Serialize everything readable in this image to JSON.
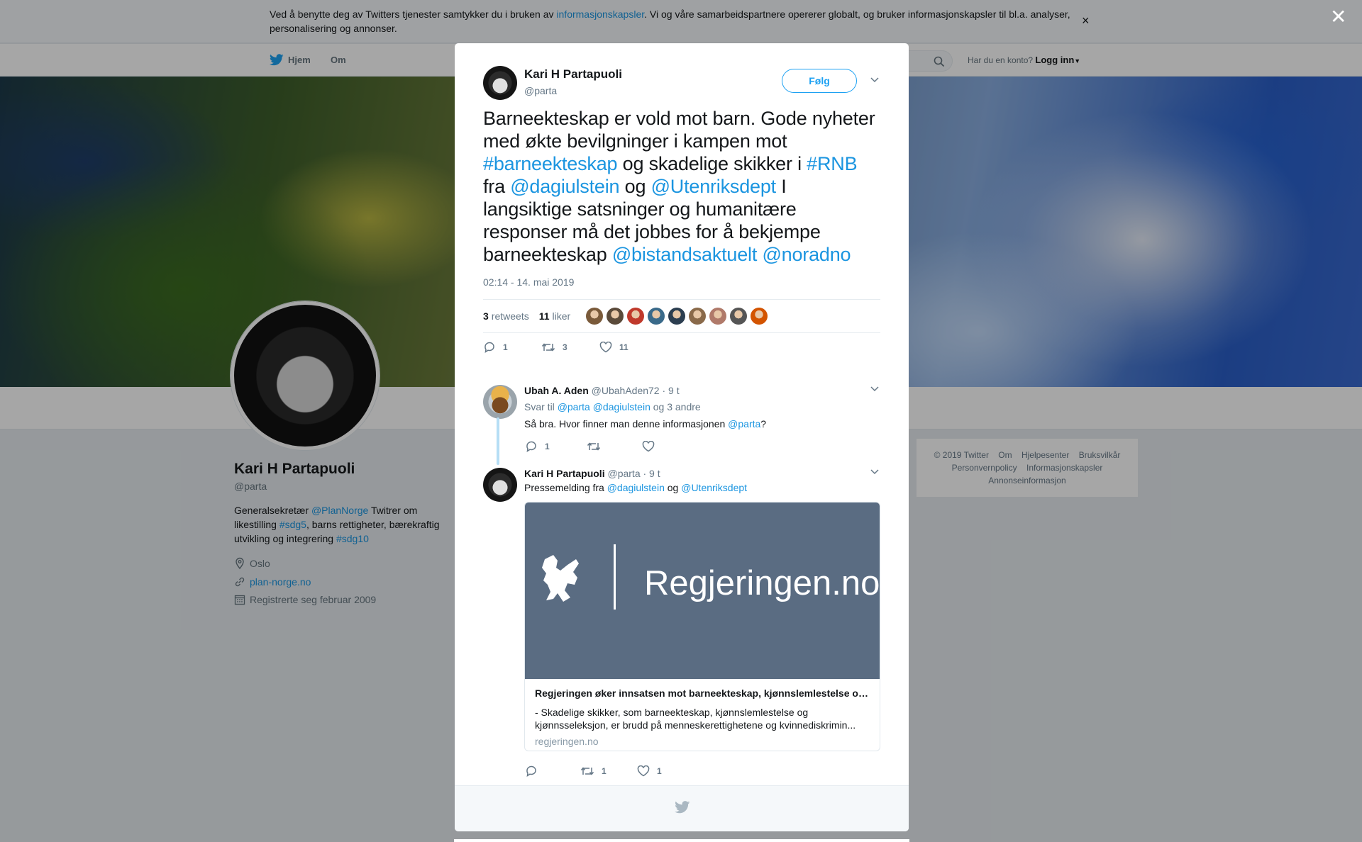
{
  "cookie_bar": {
    "text_before": "Ved å benytte deg av Twitters tjenester samtykker du i bruken av ",
    "link": "informasjonskapsler",
    "text_after": ". Vi og våre samarbeidspartnere opererer globalt, og bruker informasjonskapsler til bl.a. analyser, personalisering og annonser.",
    "close": "×"
  },
  "nav": {
    "home": "Hjem",
    "about": "Om",
    "have_account": "Har du en konto?",
    "login": "Logg inn"
  },
  "page_close": "✕",
  "profile": {
    "name": "Kari H Partapuoli",
    "handle": "@parta",
    "bio": [
      {
        "t": "Generalsekretær ",
        "link": false
      },
      {
        "t": "@PlanNorge",
        "link": true
      },
      {
        "t": " Twitrer om likestilling ",
        "link": false
      },
      {
        "t": "#sdg5",
        "link": true
      },
      {
        "t": ", barns rettigheter, bærekraftig utvikling og integrering ",
        "link": false
      },
      {
        "t": "#sdg10",
        "link": true
      }
    ],
    "location": "Oslo",
    "website": "plan-norge.no",
    "joined": "Registrerte seg februar 2009"
  },
  "footer_links": [
    "© 2019 Twitter",
    "Om",
    "Hjelpesenter",
    "Bruksvilkår",
    "Personvernpolicy",
    "Informasjonskapsler",
    "Annonseinformasjon"
  ],
  "tweet": {
    "author_name": "Kari H Partapuoli",
    "author_handle": "@parta",
    "follow_label": "Følg",
    "text": [
      {
        "t": "Barneekteskap er vold mot barn. Gode nyheter med økte bevilgninger i kampen mot ",
        "link": false
      },
      {
        "t": "#barneekteskap",
        "link": true
      },
      {
        "t": " og skadelige skikker i ",
        "link": false
      },
      {
        "t": "#RNB",
        "link": true
      },
      {
        "t": " fra ",
        "link": false
      },
      {
        "t": "@dagiulstein",
        "link": true
      },
      {
        "t": " og ",
        "link": false
      },
      {
        "t": "@Utenriksdept",
        "link": true
      },
      {
        "t": " I langsiktige satsninger og humanitære responser må det jobbes for å bekjempe barneekteskap ",
        "link": false
      },
      {
        "t": "@bistandsaktuelt",
        "link": true
      },
      {
        "t": " ",
        "link": false
      },
      {
        "t": "@noradno",
        "link": true
      }
    ],
    "timestamp": "02:14 - 14. mai 2019",
    "retweets_count": "3",
    "retweets_label": "retweets",
    "likes_count": "11",
    "likes_label": "liker",
    "likers": [
      "#7a5a3a",
      "#5a4a3a",
      "#c0392b",
      "#3a6a8a",
      "#2c3e50",
      "#8a6a4a",
      "#b07a6a",
      "#555555",
      "#d35400"
    ],
    "reply_count": "1",
    "retweet_count": "3",
    "like_count": "11"
  },
  "reply1": {
    "name": "Ubah A. Aden",
    "handle": "@UbahAden72",
    "time": "· 9 t",
    "reply_to_prefix": "Svar til ",
    "reply_to_users": "@parta @dagiulstein",
    "reply_to_suffix": " og 3 andre",
    "text_before": "Så bra. Hvor finner man denne informasjonen ",
    "text_link": "@parta",
    "text_after": "?",
    "reply_count": "1",
    "retweet_count": "",
    "like_count": ""
  },
  "reply2": {
    "name": "Kari H Partapuoli",
    "handle": "@parta",
    "time": "· 9 t",
    "text_before": "Pressemelding fra ",
    "link1": "@dagiulstein",
    "text_mid": " og ",
    "link2": "@Utenriksdept",
    "reply_count": "",
    "retweet_count": "1",
    "like_count": "1",
    "card": {
      "brand": "Regjeringen.no",
      "title": "Regjeringen øker innsatsen mot barneekteskap, kjønnslemlestelse og kjønnsseleksjon",
      "description": "- Skadelige skikker, som barneekteskap, kjønnslemlestelse og kjønnsseleksjon, er brudd på menneskerettighetene og kvinnediskrimin...",
      "domain": "regjeringen.no"
    }
  }
}
